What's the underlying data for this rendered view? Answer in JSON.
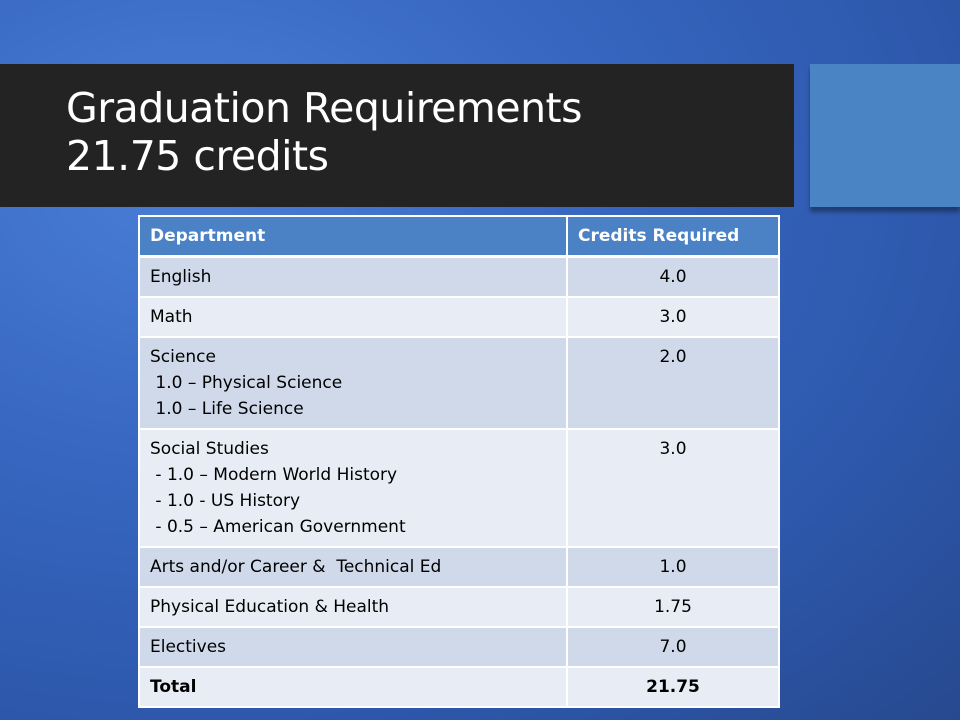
{
  "slide": {
    "title_line1": "Graduation Requirements",
    "title_line2": "21.75 credits"
  },
  "table": {
    "headers": [
      "Department",
      "Credits Required"
    ],
    "rows": [
      {
        "department": "English",
        "sublines": [],
        "credits": "4.0"
      },
      {
        "department": "Math",
        "sublines": [],
        "credits": "3.0"
      },
      {
        "department": "Science",
        "sublines": [
          " 1.0 – Physical Science",
          " 1.0 – Life Science"
        ],
        "credits": "2.0"
      },
      {
        "department": "Social Studies",
        "sublines": [
          " - 1.0 – Modern World History",
          " - 1.0 - US History",
          " - 0.5 – American Government"
        ],
        "credits": "3.0"
      },
      {
        "department": "Arts and/or Career &  Technical Ed",
        "sublines": [],
        "credits": "1.0"
      },
      {
        "department": "Physical Education & Health",
        "sublines": [],
        "credits": "1.75"
      },
      {
        "department": "Electives",
        "sublines": [],
        "credits": "7.0"
      },
      {
        "department": "Total",
        "sublines": [],
        "credits": "21.75"
      }
    ]
  },
  "colors": {
    "background": "#3868c2",
    "title_bar": "#232323",
    "accent_box": "#4a84c4",
    "header_fill": "#4b82c6",
    "row_dark": "#cfd9ea",
    "row_light": "#e8edf5"
  }
}
